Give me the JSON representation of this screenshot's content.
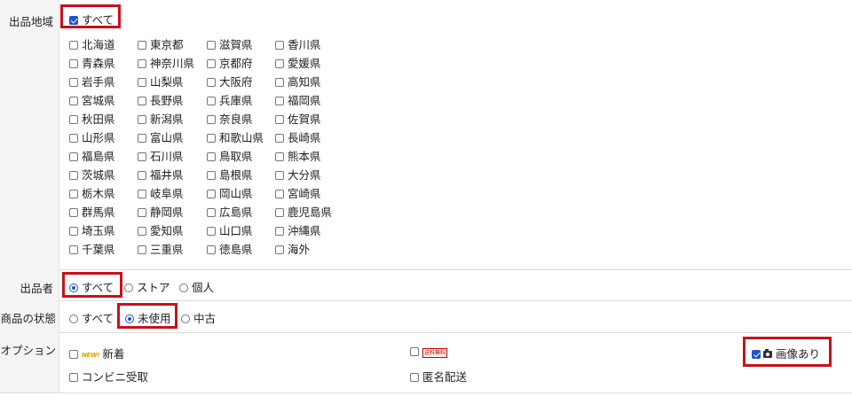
{
  "region": {
    "label": "出品地域",
    "all_label": "すべて",
    "all_checked": true,
    "columns": [
      [
        "北海道",
        "青森県",
        "岩手県",
        "宮城県",
        "秋田県",
        "山形県",
        "福島県",
        "茨城県",
        "栃木県",
        "群馬県",
        "埼玉県",
        "千葉県"
      ],
      [
        "東京都",
        "神奈川県",
        "山梨県",
        "長野県",
        "新潟県",
        "富山県",
        "石川県",
        "福井県",
        "岐阜県",
        "静岡県",
        "愛知県",
        "三重県"
      ],
      [
        "滋賀県",
        "京都府",
        "大阪府",
        "兵庫県",
        "奈良県",
        "和歌山県",
        "鳥取県",
        "島根県",
        "岡山県",
        "広島県",
        "山口県",
        "徳島県"
      ],
      [
        "香川県",
        "愛媛県",
        "高知県",
        "福岡県",
        "佐賀県",
        "長崎県",
        "熊本県",
        "大分県",
        "宮崎県",
        "鹿児島県",
        "沖縄県",
        "海外"
      ]
    ]
  },
  "seller": {
    "label": "出品者",
    "options": [
      "すべて",
      "ストア",
      "個人"
    ],
    "selected": 0
  },
  "condition": {
    "label": "商品の状態",
    "options": [
      "すべて",
      "未使用",
      "中古"
    ],
    "selected": 1
  },
  "options": {
    "label": "オプション",
    "new_badge": "NEW!",
    "new_label": "新着",
    "free_shipping_badge": "送料無料",
    "image_label": "画像あり",
    "image_checked": true,
    "convenience_label": "コンビニ受取",
    "anonymous_label": "匿名配送",
    "icons": {
      "image": "camera-icon"
    }
  },
  "colors": {
    "highlight": "#c8101a",
    "accent": "#1a56c8",
    "label_bg": "#f4f4f4"
  }
}
